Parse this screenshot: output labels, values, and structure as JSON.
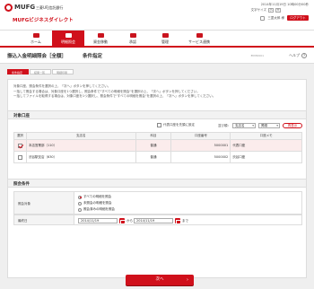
{
  "header": {
    "brand": "MUFG",
    "bank_name": "三菱UFJ信託銀行",
    "service_name": "MUFGビジネスダイレクト",
    "datetime": "2014年11月19日 10時00分00秒",
    "font_size_label": "文字サイズ",
    "font_small": "小",
    "font_large": "大",
    "user_name": "三菱太郎 様",
    "logout_label": "ログアウト"
  },
  "nav": {
    "items": [
      {
        "label": "ホーム",
        "icon": "home-icon"
      },
      {
        "label": "明細照会",
        "icon": "statement-icon"
      },
      {
        "label": "資金移動",
        "icon": "transfer-icon"
      },
      {
        "label": "承認",
        "icon": "approval-icon"
      },
      {
        "label": "管理",
        "icon": "admin-icon"
      },
      {
        "label": "サービス連携",
        "icon": "service-icon"
      }
    ],
    "active_index": 1
  },
  "page": {
    "title": "振込入金明細照会［全額］",
    "step_title": "条件指定",
    "screen_code": "BYMO001",
    "help_label": "ヘルプ",
    "help_icon": "?"
  },
  "steps": [
    "条件指定",
    "結果一覧",
    "明細印刷"
  ],
  "instructions": [
    "対象口座、照会条件を選択の上、「次へ」ボタンを押してください。",
    "一括して照会する場合は、対象口座を1つ選択し、照会条件で\"すべての明細を照会\"を選択の上、「次へ」ボタンを押してください。",
    "一括してファイルを取得する場合は、対象口座を1つ選択し、照会条件で\"すべての明細を照会\"を選択の上、「次へ」ボタンを押してください。"
  ],
  "accounts": {
    "section_title": "対象口座",
    "show_representative_label": "代表口座を先頭に設定",
    "sort_label": "並び順：",
    "sort_value": "支店名",
    "order_value": "昇順",
    "sort_button": "再表示",
    "columns": [
      "選択",
      "支店名",
      "科目",
      "口座番号",
      "口座メモ"
    ],
    "rows": [
      {
        "checked": true,
        "branch": "本店営業部（110）",
        "type": "普通",
        "number": "5000001",
        "memo": "代表口座"
      },
      {
        "checked": false,
        "branch": "渋谷駅支店（630）",
        "type": "普通",
        "number": "5000002",
        "memo": "渋谷口座"
      }
    ]
  },
  "conditions": {
    "section_title": "照会条件",
    "target_label": "照会対象",
    "options": [
      "すべての明細を照会",
      "未照会の明細を照会",
      "照会済みの明細を照会"
    ],
    "selected_option": 0,
    "date_label": "最終日",
    "date_from": "2014/11/19",
    "date_to": "2014/11/19",
    "from_label": "から",
    "to_label": "まで"
  },
  "actions": {
    "next_label": "次へ"
  },
  "colors": {
    "accent": "#d0101b",
    "background": "#efefef"
  }
}
